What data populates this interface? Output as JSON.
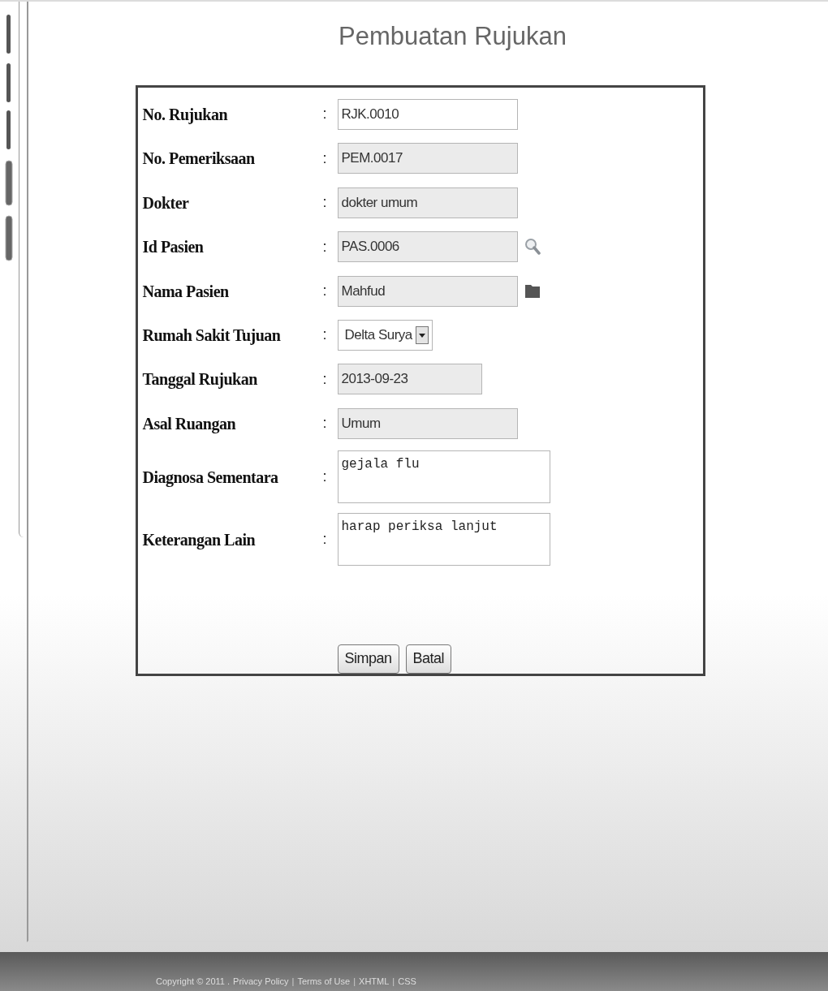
{
  "page_title": "Pembuatan Rujukan",
  "fields": [
    {
      "label": "No. Rujukan",
      "separator": ":",
      "kind": "text",
      "value": "RJK.0010",
      "disabled": false
    },
    {
      "label": "No. Pemeriksaan",
      "separator": ":",
      "kind": "text",
      "value": "PEM.0017",
      "disabled": true
    },
    {
      "label": "Dokter",
      "separator": ":",
      "kind": "text",
      "value": "dokter umum",
      "disabled": true
    },
    {
      "label": "Id Pasien",
      "separator": ":",
      "kind": "text",
      "value": "PAS.0006",
      "disabled": true
    },
    {
      "label": "Nama Pasien",
      "separator": ":",
      "kind": "text",
      "value": "Mahfud",
      "disabled": true
    },
    {
      "label": "Rumah Sakit Tujuan",
      "separator": ":",
      "kind": "select",
      "value": "Delta Surya",
      "disabled": false
    },
    {
      "label": "Tanggal Rujukan",
      "separator": ":",
      "kind": "date",
      "value": "2013-09-23",
      "disabled": true
    },
    {
      "label": "Asal Ruangan",
      "separator": ":",
      "kind": "text",
      "value": "Umum",
      "disabled": true
    },
    {
      "label": "Diagnosa Sementara",
      "separator": ":",
      "kind": "textarea",
      "value": "gejala flu",
      "disabled": false
    },
    {
      "label": "Keterangan Lain",
      "separator": ":",
      "kind": "textarea",
      "value": "harap periksa lanjut",
      "disabled": false
    }
  ],
  "buttons": [
    "Simpan",
    "Batal"
  ],
  "footer": [
    {
      "kind": "text",
      "text": "Copyright © 2011 ."
    },
    {
      "kind": "link",
      "text": "Privacy Policy"
    },
    {
      "kind": "separator",
      "text": "|"
    },
    {
      "kind": "link",
      "text": "Terms of Use"
    },
    {
      "kind": "separator",
      "text": "|"
    },
    {
      "kind": "link",
      "text": "XHTML"
    },
    {
      "kind": "separator",
      "text": "|"
    },
    {
      "kind": "link",
      "text": "CSS"
    }
  ]
}
